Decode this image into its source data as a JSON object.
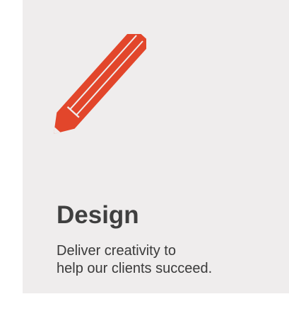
{
  "card": {
    "icon": "pencil-icon",
    "accent_color": "#e2462b",
    "title": "Design",
    "description_lines": [
      "Deliver creativity to",
      "help our clients succeed."
    ]
  }
}
